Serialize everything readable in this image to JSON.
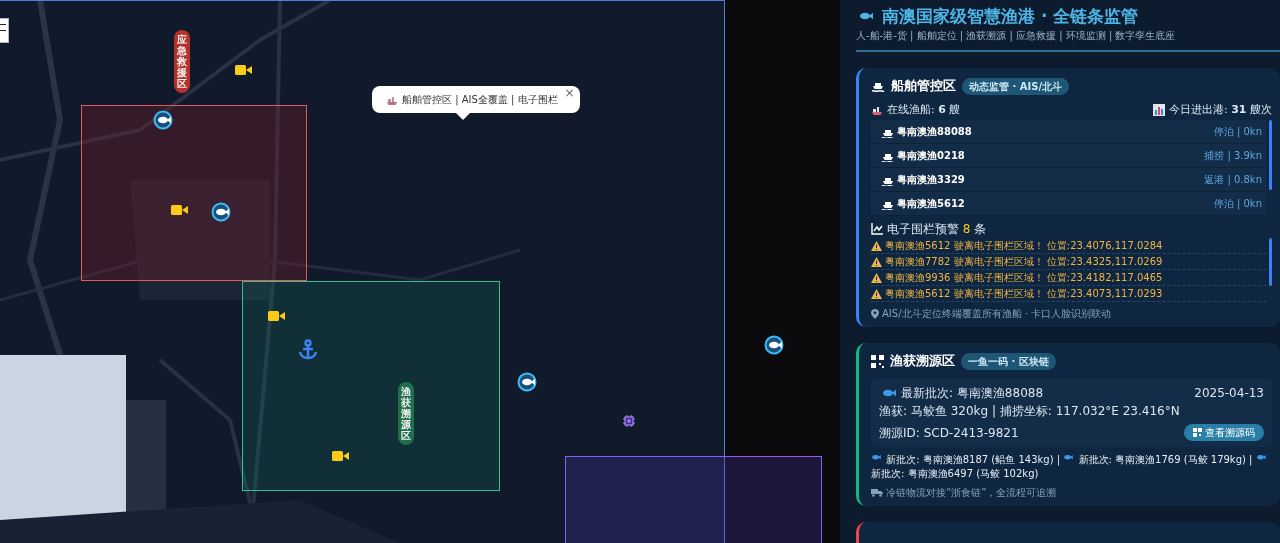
{
  "map": {
    "zone_labels": [
      {
        "text": "应急救援区"
      },
      {
        "text": "渔获溯源区"
      }
    ],
    "popup": {
      "text": "船舶管控区 | AIS全覆盖 | 电子围栏",
      "close": "×"
    }
  },
  "header": {
    "title": "南澳国家级智慧渔港 · 全链条监管",
    "subtitle": "人-船-港-货 | 船舶定位 | 渔获溯源 | 应急救援 | 环境监测 | 数字孪生底座"
  },
  "vessel_zone": {
    "title": "船舶管控区",
    "badge": "动态监管 · AIS/北斗",
    "online": {
      "label": "在线渔船:",
      "value": "6",
      "unit": "艘"
    },
    "port": {
      "label": "今日进出港:",
      "value": "31",
      "unit": "艘次"
    },
    "vessels": [
      {
        "name": "粤南澳渔88088",
        "status": "停泊 | 0kn"
      },
      {
        "name": "粤南澳渔0218",
        "status": "捕捞 | 3.9kn"
      },
      {
        "name": "粤南澳渔3329",
        "status": "返港 | 0.8kn"
      },
      {
        "name": "粤南澳渔5612",
        "status": "停泊 | 0kn"
      }
    ],
    "alerts": {
      "title": "电子围栏预警",
      "count": "8",
      "unit": "条",
      "items": [
        "粤南澳渔5612 驶离电子围栏区域！ 位置:23.4076,117.0284",
        "粤南澳渔7782 驶离电子围栏区域！ 位置:23.4325,117.0269",
        "粤南澳渔9936 驶离电子围栏区域！ 位置:23.4182,117.0465",
        "粤南澳渔5612 驶离电子围栏区域！ 位置:23.4073,117.0293"
      ]
    },
    "footer": "AIS/北斗定位终端覆盖所有渔船 · 卡口人脸识别联动"
  },
  "trace_zone": {
    "title": "渔获溯源区",
    "badge": "一鱼一码 · 区块链",
    "latest": {
      "batch": "最新批次: 粤南澳渔88088",
      "date": "2025-04-13",
      "catch": "渔获: 马鲛鱼 320kg | 捕捞坐标: 117.032°E 23.416°N",
      "trace_id": "溯源ID: SCD-2413-9821",
      "button": "查看溯源码"
    },
    "batches": [
      "新批次: 粤南澳渔8187 (鲳鱼 143kg)",
      "新批次: 粤南澳渔1769 (马鲛 179kg)",
      "新批次: 粤南澳渔6497 (马鲛 102kg)"
    ],
    "separator": "|",
    "footer": "冷链物流对接“浙食链”，全流程可追溯"
  }
}
